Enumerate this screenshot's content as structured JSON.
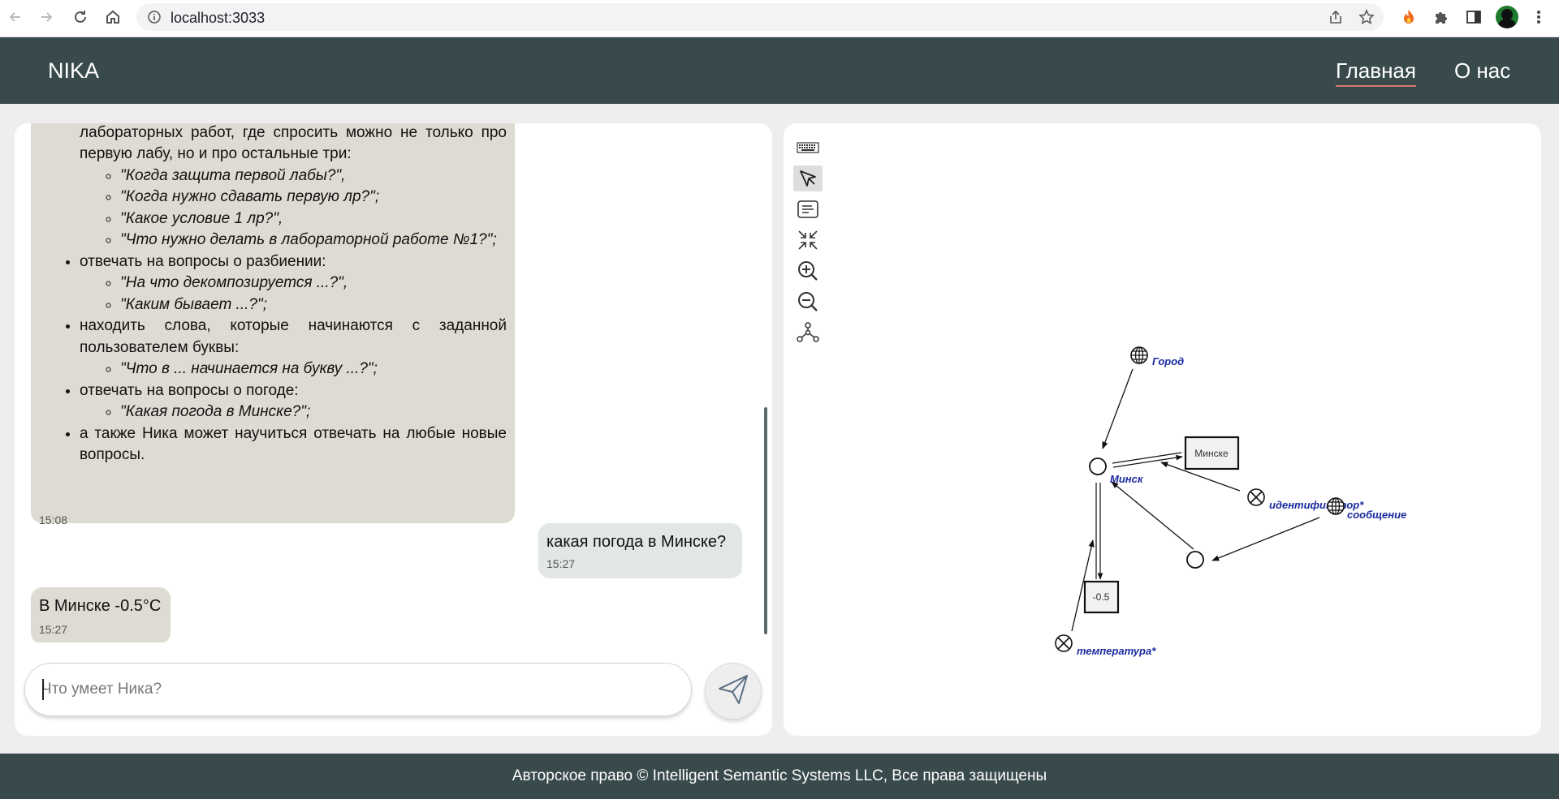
{
  "browser": {
    "url": "localhost:3033"
  },
  "header": {
    "brand": "NIKA",
    "nav": [
      {
        "label": "Главная",
        "active": true
      },
      {
        "label": "О нас",
        "active": false
      }
    ]
  },
  "chat": {
    "messages": [
      {
        "role": "bot",
        "intro": "отвечать на вопросы про условия и срок сдачи лабораторных работ, где спросить можно не только про первую лабу, но и про остальные три:",
        "intro_examples": [
          "\"Когда защита первой лабы?\",",
          "\"Когда нужно сдавать первую лр?\";",
          "\"Какое условие 1 лр?\",",
          "\"Что нужно делать в лабораторной работе №1?\";"
        ],
        "items": [
          {
            "text": "отвечать на вопросы о разбиении:",
            "examples": [
              "\"На что декомпозируется ...?\",",
              "\"Каким бывает ...?\";"
            ]
          },
          {
            "text": "находить слова, которые начинаются с заданной пользователем буквы:",
            "examples": [
              "\"Что в ... начинается на букву ...?\";"
            ]
          },
          {
            "text": "отвечать на вопросы о погоде:",
            "examples": [
              "\"Какая погода в Минске?\";"
            ]
          },
          {
            "text": "а также Ника может научиться отвечать на любые новые вопросы.",
            "examples": []
          }
        ],
        "time": "15:08"
      },
      {
        "role": "user",
        "text": "какая погода в Минске?",
        "time": "15:27"
      },
      {
        "role": "bot",
        "text": "В Минске -0.5°C",
        "time": "15:27"
      }
    ],
    "input": {
      "placeholder": "Что умеет Ника?",
      "value": ""
    }
  },
  "graph": {
    "tools": [
      {
        "name": "keyboard-icon",
        "selected": false
      },
      {
        "name": "pointer-icon",
        "selected": true
      },
      {
        "name": "text-icon",
        "selected": false
      },
      {
        "name": "collapse-icon",
        "selected": false
      },
      {
        "name": "zoom-in-icon",
        "selected": false
      },
      {
        "name": "zoom-out-icon",
        "selected": false
      },
      {
        "name": "graph-layout-icon",
        "selected": false
      }
    ],
    "labels": {
      "gorod": "Город",
      "minsk": "Минск",
      "minske_link": "Минске",
      "identifier": "идентификатор*",
      "message": "сообщение",
      "value_link": "-0.5",
      "temperature": "температура*"
    }
  },
  "footer": {
    "text": "Авторское право © Intelligent Semantic Systems LLC, Все права защищены"
  },
  "colors": {
    "header_bg": "#384a4c",
    "bot_bubble": "#dedbd2",
    "user_bubble": "#e2e6e4",
    "active_underline": "#d97a72",
    "graph_label": "#1a2aa0"
  }
}
